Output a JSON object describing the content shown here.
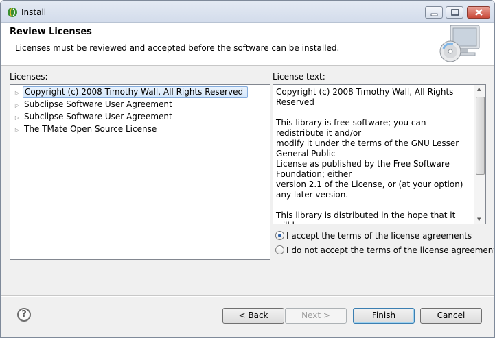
{
  "window": {
    "title": "Install"
  },
  "banner": {
    "title": "Review Licenses",
    "description": "Licenses must be reviewed and accepted before the software can be installed."
  },
  "licenses": {
    "label": "Licenses:",
    "items": [
      {
        "label": "Copyright (c) 2008 Timothy Wall, All Rights Reserved",
        "selected": true
      },
      {
        "label": "Subclipse Software User Agreement",
        "selected": false
      },
      {
        "label": "Subclipse Software User Agreement",
        "selected": false
      },
      {
        "label": "The TMate Open Source License",
        "selected": false
      }
    ]
  },
  "license_text": {
    "label": "License text:",
    "body": "Copyright (c) 2008 Timothy Wall, All Rights Reserved\n\nThis library is free software; you can redistribute it and/or\nmodify it under the terms of the GNU Lesser General Public\nLicense as published by the Free Software Foundation; either\nversion 2.1 of the License, or (at your option) any later version.\n\nThis library is distributed in the hope that it will be"
  },
  "agreement": {
    "accept": "I accept the terms of the license agreements",
    "decline": "I do not accept the terms of the license agreements",
    "selected": "accept"
  },
  "buttons": {
    "back": "< Back",
    "next": "Next >",
    "finish": "Finish",
    "cancel": "Cancel"
  },
  "help": {
    "glyph": "?"
  }
}
